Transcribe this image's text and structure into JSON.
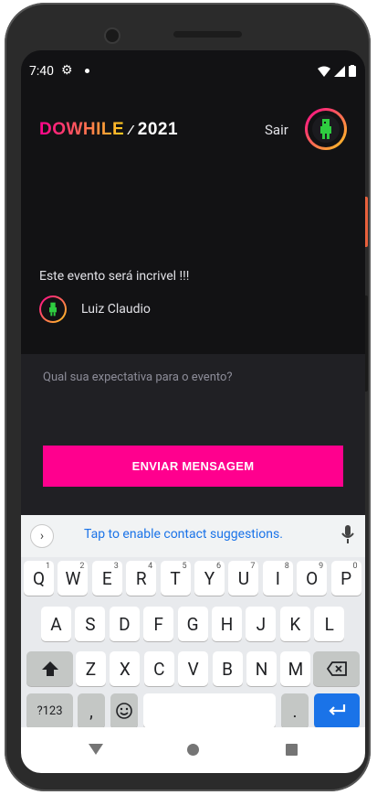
{
  "status": {
    "time": "7:40"
  },
  "header": {
    "logo_part1": "DOWHILE",
    "logo_part2": "2021",
    "signout_label": "Sair"
  },
  "message": {
    "text": "Este evento será incrivel !!!",
    "user_name": "Luiz Claudio"
  },
  "form": {
    "placeholder": "Qual sua expectativa para o evento?",
    "submit_label": "ENVIAR MENSAGEM"
  },
  "keyboard": {
    "suggestion": "Tap to enable contact suggestions.",
    "row1": [
      [
        "Q",
        "1"
      ],
      [
        "W",
        "2"
      ],
      [
        "E",
        "3"
      ],
      [
        "R",
        "4"
      ],
      [
        "T",
        "5"
      ],
      [
        "Y",
        "6"
      ],
      [
        "U",
        "7"
      ],
      [
        "I",
        "8"
      ],
      [
        "O",
        "9"
      ],
      [
        "P",
        "0"
      ]
    ],
    "row2": [
      "A",
      "S",
      "D",
      "F",
      "G",
      "H",
      "J",
      "K",
      "L"
    ],
    "row3": [
      "Z",
      "X",
      "C",
      "V",
      "B",
      "N",
      "M"
    ],
    "sym_label": "?123",
    "comma": ",",
    "period": "."
  },
  "colors": {
    "background": "#121214",
    "accent": "#ff008e",
    "gradient_end": "#ffcd1e",
    "link": "#1a73e8"
  }
}
